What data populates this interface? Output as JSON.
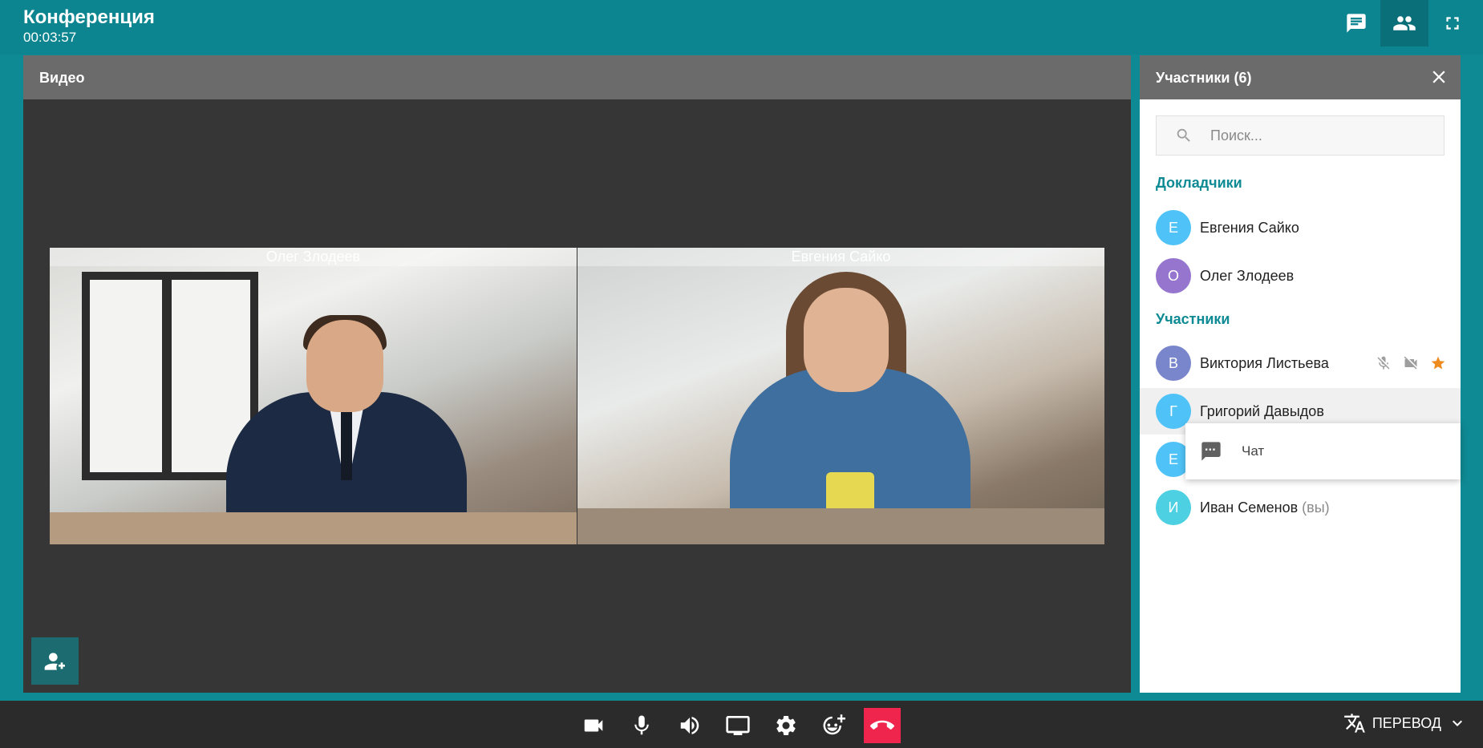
{
  "header": {
    "title": "Конференция",
    "timer": "00:03:57",
    "buttons": [
      {
        "name": "chat-icon"
      },
      {
        "name": "participants-icon",
        "active": true
      },
      {
        "name": "fullscreen-icon"
      }
    ]
  },
  "video": {
    "panel_title": "Видео",
    "tiles": [
      {
        "name": "Олег Злодеев"
      },
      {
        "name": "Евгения Сайко"
      }
    ],
    "add_participant_icon": "add-participant-icon"
  },
  "participants": {
    "panel_title": "Участники (6)",
    "search_placeholder": "Поиск...",
    "sections": {
      "speakers": "Докладчики",
      "participants": "Участники"
    },
    "speakers": [
      {
        "initial": "Е",
        "name": "Евгения Сайко",
        "color": "#4fc3f7"
      },
      {
        "initial": "О",
        "name": "Олег Злодеев",
        "color": "#9575cd"
      }
    ],
    "members": [
      {
        "initial": "В",
        "name": "Виктория Листьева",
        "color": "#7986cb",
        "icons": [
          "mic-off-icon",
          "video-off-icon",
          "star-icon"
        ]
      },
      {
        "initial": "Г",
        "name": "Григорий Давыдов",
        "color": "#4fc3f7",
        "highlighted": true
      },
      {
        "initial": "Е",
        "name": "",
        "color": "#4fc3f7"
      },
      {
        "initial": "И",
        "name": "Иван Семенов",
        "suffix": "(вы)",
        "color": "#4dd0e1"
      }
    ],
    "context_menu": {
      "label": "Чат",
      "icon": "chat-icon"
    }
  },
  "toolbar": {
    "buttons": [
      "camera-icon",
      "microphone-icon",
      "speaker-icon",
      "screen-share-icon",
      "settings-icon",
      "reaction-icon",
      "hangup-icon"
    ],
    "translate_label": "ПЕРЕВОД"
  },
  "colors": {
    "accent": "#0e8a94",
    "hangup": "#f0254e",
    "star": "#ef8b1e"
  }
}
